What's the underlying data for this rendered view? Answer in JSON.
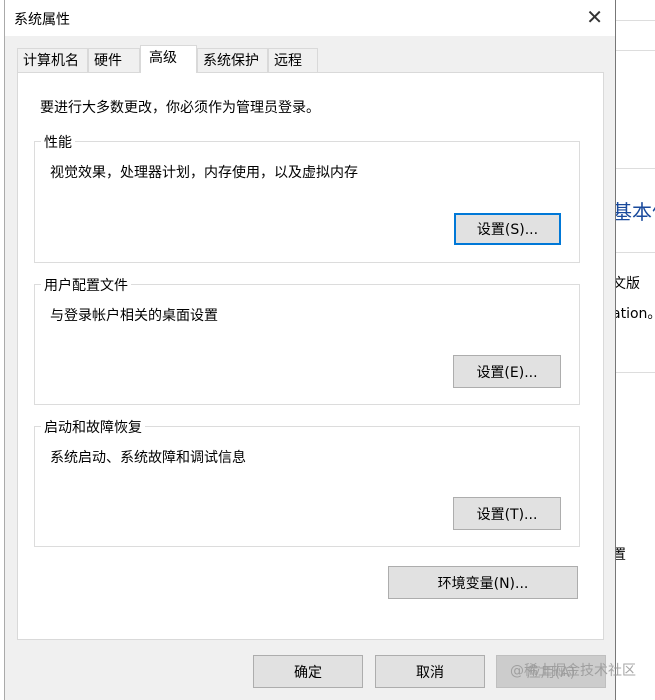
{
  "background": {
    "texts": [
      "基本信",
      "文版",
      "ation。",
      "置"
    ]
  },
  "dialog": {
    "title": "系统属性",
    "tabs": [
      {
        "label": "计算机名"
      },
      {
        "label": "硬件"
      },
      {
        "label": "高级"
      },
      {
        "label": "系统保护"
      },
      {
        "label": "远程"
      }
    ],
    "admin_note": "要进行大多数更改，你必须作为管理员登录。",
    "groups": [
      {
        "label": "性能",
        "desc": "视觉效果，处理器计划，内存使用，以及虚拟内存",
        "button": "设置(S)..."
      },
      {
        "label": "用户配置文件",
        "desc": "与登录帐户相关的桌面设置",
        "button": "设置(E)..."
      },
      {
        "label": "启动和故障恢复",
        "desc": "系统启动、系统故障和调试信息",
        "button": "设置(T)..."
      }
    ],
    "env_button": "环境变量(N)...",
    "ok": "确定",
    "cancel": "取消",
    "apply": "应用(A)"
  },
  "watermark": "@稀土掘金技术社区",
  "colors": {
    "focus": "#0078d7",
    "link": "#1a4a9c"
  }
}
